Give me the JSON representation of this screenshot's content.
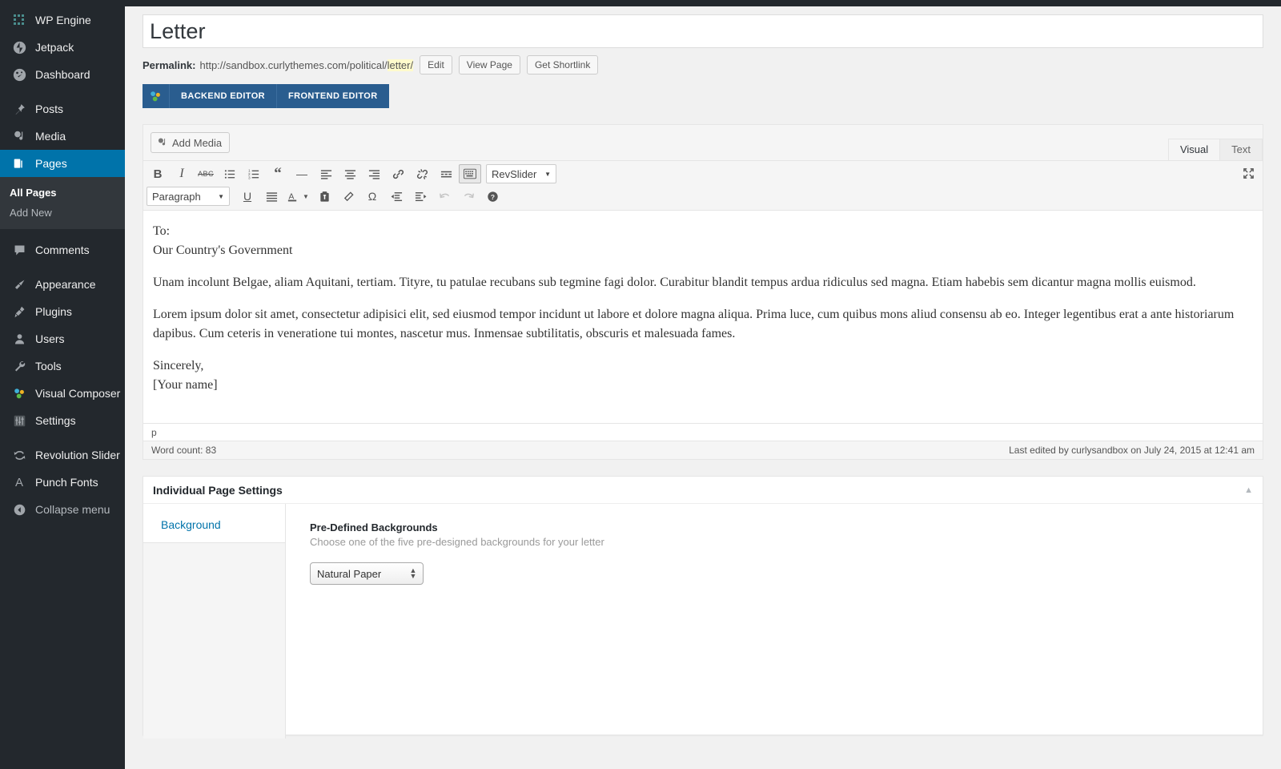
{
  "sidebar": {
    "items": [
      {
        "label": "WP Engine",
        "icon": "wp-engine-icon",
        "name": "sidebar-item-wp-engine"
      },
      {
        "label": "Jetpack",
        "icon": "jetpack-icon",
        "name": "sidebar-item-jetpack"
      },
      {
        "label": "Dashboard",
        "icon": "dashboard-icon",
        "name": "sidebar-item-dashboard"
      },
      {
        "label": "Posts",
        "icon": "pin-icon",
        "name": "sidebar-item-posts"
      },
      {
        "label": "Media",
        "icon": "media-icon",
        "name": "sidebar-item-media"
      },
      {
        "label": "Pages",
        "icon": "pages-icon",
        "name": "sidebar-item-pages"
      },
      {
        "label": "Comments",
        "icon": "comments-icon",
        "name": "sidebar-item-comments"
      },
      {
        "label": "Appearance",
        "icon": "brush-icon",
        "name": "sidebar-item-appearance"
      },
      {
        "label": "Plugins",
        "icon": "plug-icon",
        "name": "sidebar-item-plugins"
      },
      {
        "label": "Users",
        "icon": "user-icon",
        "name": "sidebar-item-users"
      },
      {
        "label": "Tools",
        "icon": "wrench-icon",
        "name": "sidebar-item-tools"
      },
      {
        "label": "Visual Composer",
        "icon": "visual-composer-icon",
        "name": "sidebar-item-visual-composer"
      },
      {
        "label": "Settings",
        "icon": "sliders-icon",
        "name": "sidebar-item-settings"
      },
      {
        "label": "Revolution Slider",
        "icon": "revolution-slider-icon",
        "name": "sidebar-item-revolution-slider"
      },
      {
        "label": "Punch Fonts",
        "icon": "letter-a-icon",
        "name": "sidebar-item-punch-fonts"
      }
    ],
    "pages_submenu": [
      {
        "label": "All Pages",
        "active": true
      },
      {
        "label": "Add New",
        "active": false
      }
    ],
    "collapse": {
      "label": "Collapse menu",
      "icon": "collapse-arrow-icon"
    },
    "active_item": "Pages",
    "accent_color": "#0073aa"
  },
  "page": {
    "title_value": "Letter",
    "title_placeholder": "Enter title here"
  },
  "permalink": {
    "label": "Permalink:",
    "url_prefix": "http://sandbox.curlythemes.com/political/",
    "slug": "letter/",
    "buttons": [
      {
        "label": "Edit",
        "name": "permalink-edit-button"
      },
      {
        "label": "View Page",
        "name": "view-page-button"
      },
      {
        "label": "Get Shortlink",
        "name": "get-shortlink-button"
      }
    ],
    "highlight_color": "#fffbcc"
  },
  "vc_bar": {
    "logo_icon": "visual-composer-icon",
    "tabs": [
      {
        "label": "BACKEND EDITOR",
        "name": "backend-editor-tab"
      },
      {
        "label": "FRONTEND EDITOR",
        "name": "frontend-editor-tab"
      }
    ],
    "background_color": "#2a5d8f"
  },
  "editor": {
    "add_media_label": "Add Media",
    "tabs": [
      {
        "label": "Visual",
        "active": true,
        "name": "tab-visual"
      },
      {
        "label": "Text",
        "active": false,
        "name": "tab-text"
      }
    ],
    "toolbar_row1": [
      {
        "icon": "bold-icon",
        "name": "bold-button",
        "glyph": "B"
      },
      {
        "icon": "italic-icon",
        "name": "italic-button",
        "glyph": "I"
      },
      {
        "icon": "strikethrough-icon",
        "name": "strikethrough-button",
        "glyph": "ABC"
      },
      {
        "icon": "bulleted-list-icon",
        "name": "bulleted-list-button",
        "glyph": ""
      },
      {
        "icon": "numbered-list-icon",
        "name": "numbered-list-button",
        "glyph": ""
      },
      {
        "icon": "blockquote-icon",
        "name": "blockquote-button",
        "glyph": "“"
      },
      {
        "icon": "horizontal-rule-icon",
        "name": "horizontal-rule-button",
        "glyph": "—"
      },
      {
        "icon": "align-left-icon",
        "name": "align-left-button",
        "glyph": ""
      },
      {
        "icon": "align-center-icon",
        "name": "align-center-button",
        "glyph": ""
      },
      {
        "icon": "align-right-icon",
        "name": "align-right-button",
        "glyph": ""
      },
      {
        "icon": "link-icon",
        "name": "insert-link-button",
        "glyph": ""
      },
      {
        "icon": "unlink-icon",
        "name": "remove-link-button",
        "glyph": ""
      },
      {
        "icon": "read-more-icon",
        "name": "insert-read-more-button",
        "glyph": ""
      },
      {
        "icon": "keyboard-icon",
        "name": "toggle-toolbar-button",
        "glyph": "",
        "pressed": true
      }
    ],
    "revslider_label": "RevSlider",
    "paragraph_label": "Paragraph",
    "toolbar_row2": [
      {
        "icon": "underline-icon",
        "name": "underline-button",
        "glyph": "U"
      },
      {
        "icon": "justify-icon",
        "name": "justify-button",
        "glyph": ""
      },
      {
        "icon": "text-color-icon",
        "name": "text-color-button",
        "glyph": "A"
      },
      {
        "icon": "paste-as-text-icon",
        "name": "paste-as-text-button",
        "glyph": ""
      },
      {
        "icon": "clear-formatting-icon",
        "name": "clear-formatting-button",
        "glyph": ""
      },
      {
        "icon": "special-character-icon",
        "name": "special-character-button",
        "glyph": "Ω"
      },
      {
        "icon": "outdent-icon",
        "name": "outdent-button",
        "glyph": ""
      },
      {
        "icon": "indent-icon",
        "name": "indent-button",
        "glyph": ""
      },
      {
        "icon": "undo-icon",
        "name": "undo-button",
        "glyph": "",
        "disabled": true
      },
      {
        "icon": "redo-icon",
        "name": "redo-button",
        "glyph": "",
        "disabled": true
      },
      {
        "icon": "help-icon",
        "name": "keyboard-shortcuts-button",
        "glyph": "?"
      }
    ],
    "fullscreen_icon": "fullscreen-icon",
    "content": {
      "to_line": "To:",
      "recipient": "Our Country's Government",
      "paragraph1": "Unam incolunt Belgae, aliam Aquitani, tertiam. Tityre, tu patulae recubans sub tegmine fagi dolor. Curabitur blandit tempus ardua ridiculus sed magna. Etiam habebis sem dicantur magna mollis euismod.",
      "paragraph2": "Lorem ipsum dolor sit amet, consectetur adipisici elit, sed eiusmod tempor incidunt ut labore et dolore magna aliqua. Prima luce, cum quibus mons aliud consensu ab eo. Integer legentibus erat a ante historiarum dapibus. Cum ceteris in veneratione tui montes, nascetur mus. Inmensae subtilitatis, obscuris et malesuada fames.",
      "signoff": "Sincerely,",
      "signature": "[Your name]"
    },
    "path": "p",
    "word_count": "Word count: 83",
    "last_edited": "Last edited by curlysandbox on July 24, 2015 at 12:41 am"
  },
  "individual_page_settings": {
    "title": "Individual Page Settings",
    "toggle_icon": "chevron-up-icon",
    "nav": [
      {
        "label": "Background",
        "name": "ips-nav-background"
      }
    ],
    "field": {
      "title": "Pre-Defined Backgrounds",
      "description": "Choose one of the five pre-designed backgrounds for your letter",
      "select_value": "Natural Paper"
    }
  }
}
